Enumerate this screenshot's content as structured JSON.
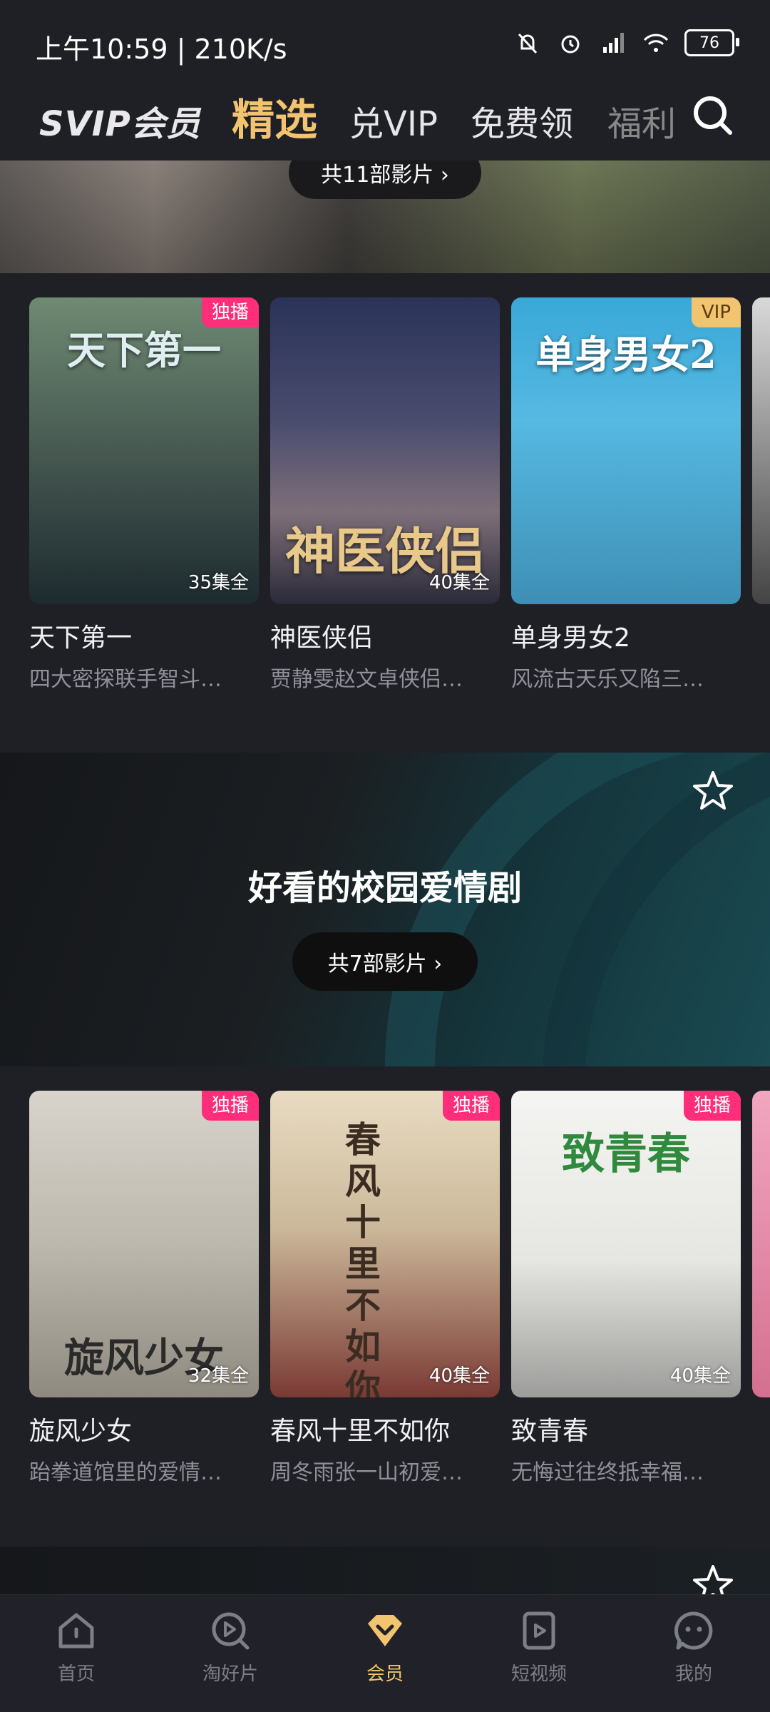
{
  "status_bar": {
    "time": "上午10:59 | 210K/s",
    "battery": "76"
  },
  "top_nav": {
    "brand": "SVIP会员",
    "tabs": [
      {
        "label": "精选",
        "active": true
      },
      {
        "label": "兑VIP"
      },
      {
        "label": "免费领"
      },
      {
        "label": "福利"
      }
    ]
  },
  "sections": [
    {
      "count_label": "共11部影片 ›",
      "cards": [
        {
          "poster_title": "天下第一",
          "badge": "独播",
          "episodes": "35集全",
          "title": "天下第一",
          "desc": "四大密探联手智斗…"
        },
        {
          "poster_title": "神医侠侣",
          "badge": "",
          "episodes": "40集全",
          "title": "神医侠侣",
          "desc": "贾静雯赵文卓侠侣…"
        },
        {
          "poster_title": "单身男女2",
          "badge": "VIP",
          "episodes": "",
          "title": "单身男女2",
          "desc": "风流古天乐又陷三…"
        }
      ]
    },
    {
      "title": "好看的校园爱情剧",
      "count_label": "共7部影片 ›",
      "cards": [
        {
          "poster_title": "旋风少女",
          "badge": "独播",
          "episodes": "32集全",
          "title": "旋风少女",
          "desc": "跆拳道馆里的爱情…"
        },
        {
          "poster_title": "春风十里不如你",
          "badge": "独播",
          "episodes": "40集全",
          "title": "春风十里不如你",
          "desc": "周冬雨张一山初爱…"
        },
        {
          "poster_title": "致青春",
          "badge": "独播",
          "episodes": "40集全",
          "title": "致青春",
          "desc": "无悔过往终抵幸福…"
        }
      ]
    }
  ],
  "bottom_nav": [
    {
      "label": "首页",
      "icon": "home-icon"
    },
    {
      "label": "淘好片",
      "icon": "discover-icon"
    },
    {
      "label": "会员",
      "icon": "vip-icon",
      "active": true
    },
    {
      "label": "短视频",
      "icon": "short-video-icon"
    },
    {
      "label": "我的",
      "icon": "profile-icon"
    }
  ],
  "colors": {
    "accent_gold": "#f2c46f",
    "badge_pink": "#ff2d7a",
    "background": "#1f2026"
  }
}
